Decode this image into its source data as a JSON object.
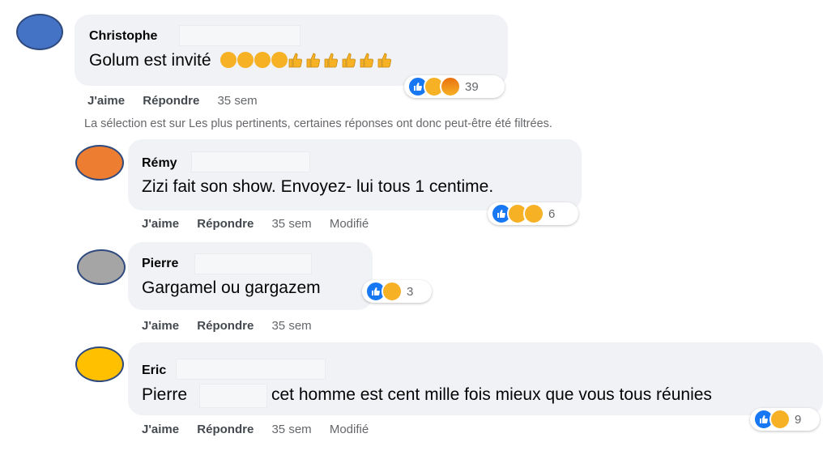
{
  "actions": {
    "like": "J'aime",
    "reply": "Répondre"
  },
  "filter_notice": "La sélection est sur Les plus pertinents, certaines réponses ont donc peut-être été filtrées.",
  "colors": {
    "avatar_1": "#4472c4",
    "avatar_2": "#ed7d31",
    "avatar_3": "#a5a5a5",
    "avatar_4": "#ffc000",
    "like_blue": "#1877f2",
    "emoji_yellow": "#f7b125"
  },
  "comments": [
    {
      "author": "Christophe",
      "text": "Golum est invité",
      "text_emoji": [
        "joy-emoji",
        "joy-emoji",
        "joy-emoji",
        "joy-emoji",
        "thumbs-up",
        "thumbs-up",
        "thumbs-up",
        "thumbs-up",
        "thumbs-up",
        "thumbs-up"
      ],
      "time": "35 sem",
      "edited": "",
      "reactions": [
        "like",
        "haha",
        "angry"
      ],
      "reaction_count": "39"
    },
    {
      "author": "Rémy",
      "text": "Zizi fait son show. Envoyez- lui tous 1 centime.",
      "time": "35 sem",
      "edited": "Modifié",
      "reactions": [
        "like",
        "haha",
        "sad"
      ],
      "reaction_count": "6"
    },
    {
      "author": "Pierre",
      "text": "Gargamel ou gargazem",
      "time": "35 sem",
      "edited": "",
      "reactions": [
        "like",
        "sad"
      ],
      "reaction_count": "3"
    },
    {
      "author": "Eric",
      "text_before": "Pierre",
      "text_after": "cet homme est cent mille fois mieux que vous tous réunies",
      "time": "35 sem",
      "edited": "Modifié",
      "reactions": [
        "like",
        "haha"
      ],
      "reaction_count": "9"
    }
  ]
}
